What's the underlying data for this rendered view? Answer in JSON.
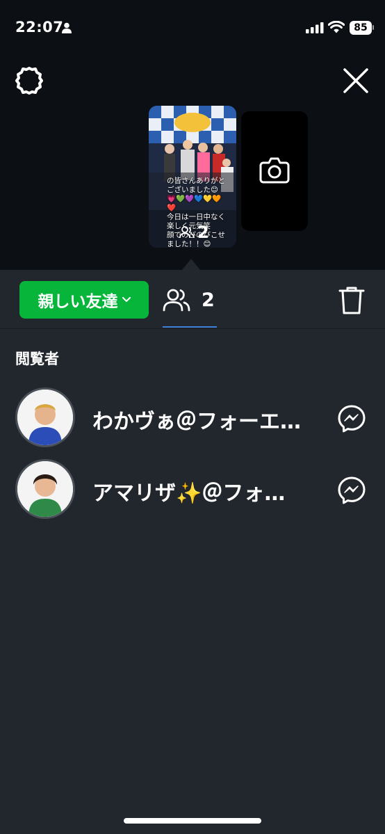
{
  "status": {
    "time": "22:07",
    "battery": "85"
  },
  "preview": {
    "caption": "の皆さんありがと\nございました😊\n💗💚💜💙💛🧡❤️\n今日は一日中なく楽しく元気笑\n顔でのびのびこせました！！😊\n💚💗💜",
    "viewer_count": "2"
  },
  "sheet": {
    "audience_label": "親しい友達",
    "viewer_count": "2",
    "section_title": "閲覧者",
    "viewers": [
      {
        "name": "わかヴぁ＠フォーエ…"
      },
      {
        "name": "アマリザ✨＠フォ…"
      }
    ]
  },
  "colors": {
    "accent_green": "#07b53b",
    "tab_underline": "#3e7fd8",
    "sheet_bg": "#22262d"
  },
  "icons": [
    "person-icon",
    "signal-icon",
    "wifi-icon",
    "settings-gear-icon",
    "close-icon",
    "camera-icon",
    "viewers-icon",
    "chevron-down-icon",
    "trash-icon",
    "messenger-icon"
  ]
}
